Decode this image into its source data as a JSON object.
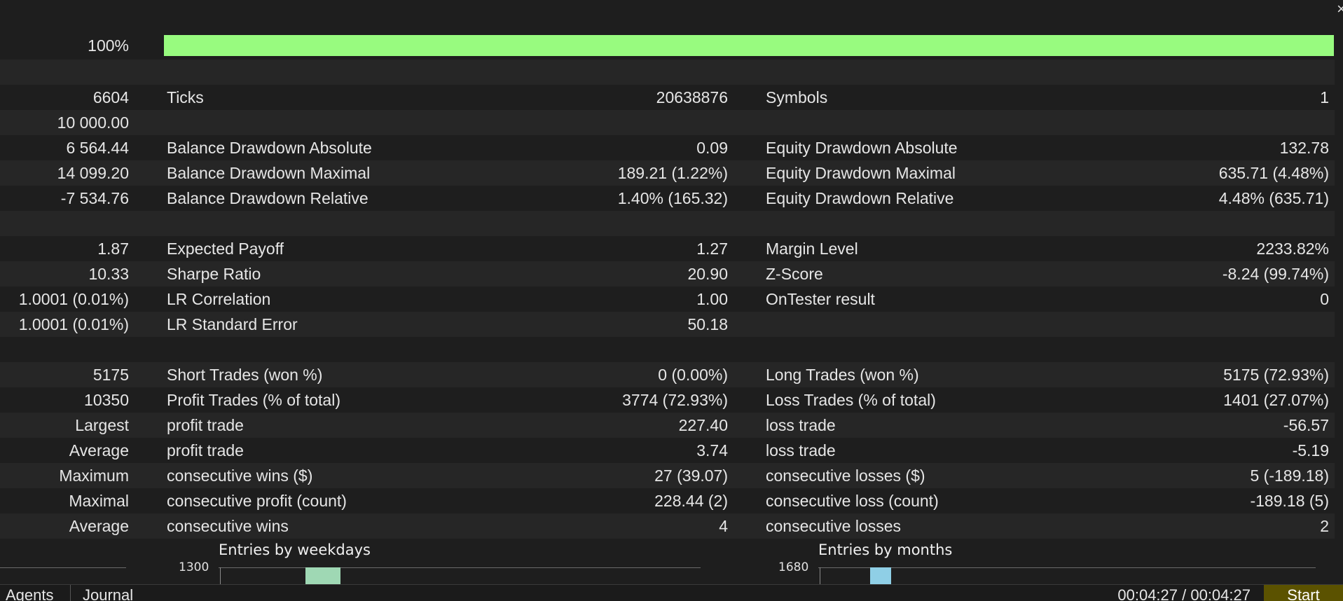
{
  "progress": {
    "label": "100%",
    "value": 1.0,
    "fill_color": "#98fb7f"
  },
  "rows": [
    {
      "c1": "",
      "c2": "",
      "c3": "",
      "c4": "",
      "c5": ""
    },
    {
      "c1": "6604",
      "c2": "Ticks",
      "c3": "20638876",
      "c4": "Symbols",
      "c5": "1"
    },
    {
      "c1": "10 000.00",
      "c2": "",
      "c3": "",
      "c4": "",
      "c5": ""
    },
    {
      "c1": "6 564.44",
      "c2": "Balance Drawdown Absolute",
      "c3": "0.09",
      "c4": "Equity Drawdown Absolute",
      "c5": "132.78"
    },
    {
      "c1": "14 099.20",
      "c2": "Balance Drawdown Maximal",
      "c3": "189.21 (1.22%)",
      "c4": "Equity Drawdown Maximal",
      "c5": "635.71 (4.48%)"
    },
    {
      "c1": "-7 534.76",
      "c2": "Balance Drawdown Relative",
      "c3": "1.40% (165.32)",
      "c4": "Equity Drawdown Relative",
      "c5": "4.48% (635.71)"
    },
    {
      "c1": "",
      "c2": "",
      "c3": "",
      "c4": "",
      "c5": ""
    },
    {
      "c1": "1.87",
      "c2": "Expected Payoff",
      "c3": "1.27",
      "c4": "Margin Level",
      "c5": "2233.82%"
    },
    {
      "c1": "10.33",
      "c2": "Sharpe Ratio",
      "c3": "20.90",
      "c4": "Z-Score",
      "c5": "-8.24 (99.74%)"
    },
    {
      "c1": "1.0001 (0.01%)",
      "c2": "LR Correlation",
      "c3": "1.00",
      "c4": "OnTester result",
      "c5": "0"
    },
    {
      "c1": "1.0001 (0.01%)",
      "c2": "LR Standard Error",
      "c3": "50.18",
      "c4": "",
      "c5": ""
    },
    {
      "c1": "",
      "c2": "",
      "c3": "",
      "c4": "",
      "c5": ""
    },
    {
      "c1": "5175",
      "c2": "Short Trades (won %)",
      "c3": "0 (0.00%)",
      "c4": "Long Trades (won %)",
      "c5": "5175 (72.93%)"
    },
    {
      "c1": "10350",
      "c2": "Profit Trades (% of total)",
      "c3": "3774 (72.93%)",
      "c4": "Loss Trades (% of total)",
      "c5": "1401 (27.07%)"
    },
    {
      "c1": "Largest",
      "c2": "profit trade",
      "c3": "227.40",
      "c4": "loss trade",
      "c5": "-56.57"
    },
    {
      "c1": "Average",
      "c2": "profit trade",
      "c3": "3.74",
      "c4": "loss trade",
      "c5": "-5.19"
    },
    {
      "c1": "Maximum",
      "c2": "consecutive wins ($)",
      "c3": "27 (39.07)",
      "c4": "consecutive losses ($)",
      "c5": "5 (-189.18)"
    },
    {
      "c1": "Maximal",
      "c2": "consecutive profit (count)",
      "c3": "228.44 (2)",
      "c4": "consecutive loss (count)",
      "c5": "-189.18 (5)"
    },
    {
      "c1": "Average",
      "c2": "consecutive wins",
      "c3": "4",
      "c4": "consecutive losses",
      "c5": "2"
    },
    {
      "c1": "",
      "c2": "",
      "c3": "",
      "c4": "",
      "c5": ""
    }
  ],
  "charts": {
    "weekdays": {
      "title": "Entries by weekdays",
      "top_tick": "1300",
      "bar_color": "#9fd8b4"
    },
    "months": {
      "title": "Entries by months",
      "top_tick": "1680",
      "bar_color": "#8fcfe6"
    }
  },
  "tabs": [
    {
      "label": "Agents"
    },
    {
      "label": "Journal"
    }
  ],
  "status": {
    "timer": "00:04:27 / 00:04:27",
    "start_label": "Start",
    "close_glyph": "×"
  }
}
